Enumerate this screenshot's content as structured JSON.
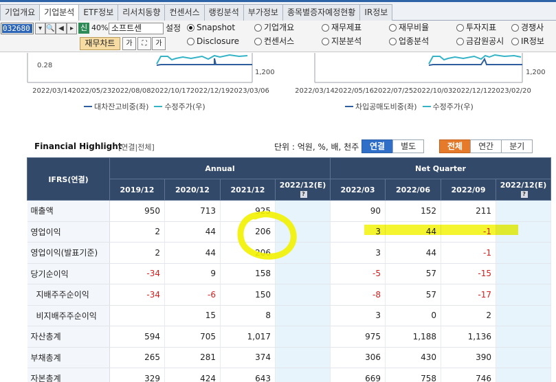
{
  "tabs": [
    {
      "label": "기업개요",
      "active": false
    },
    {
      "label": "기업분석",
      "active": true
    },
    {
      "label": "ETF정보",
      "active": false
    },
    {
      "label": "리서치동향",
      "active": false
    },
    {
      "label": "컨센서스",
      "active": false
    },
    {
      "label": "랭킹분석",
      "active": false
    },
    {
      "label": "부가정보",
      "active": false
    },
    {
      "label": "종목별증자예정현황",
      "active": false
    },
    {
      "label": "IR정보",
      "active": false
    }
  ],
  "toolbar": {
    "code": "032680",
    "shin": "신",
    "pct": "40%",
    "company": "소프트센",
    "setting": "설정",
    "fin_chart": "재무차트",
    "btn_ga": "가",
    "btn_ga2": "가"
  },
  "radios": [
    {
      "label": "Snapshot",
      "checked": true
    },
    {
      "label": "기업개요",
      "checked": false
    },
    {
      "label": "재무제표",
      "checked": false
    },
    {
      "label": "재무비율",
      "checked": false
    },
    {
      "label": "투자지표",
      "checked": false
    },
    {
      "label": "경쟁사",
      "checked": false
    },
    {
      "label": "Disclosure",
      "checked": false
    },
    {
      "label": "컨센서스",
      "checked": false
    },
    {
      "label": "지분분석",
      "checked": false
    },
    {
      "label": "업종분석",
      "checked": false
    },
    {
      "label": "금감원공시",
      "checked": false
    },
    {
      "label": "IR정보",
      "checked": false
    }
  ],
  "charts": {
    "left": {
      "ytick_left": "0.28",
      "ytick_right": "1,200",
      "xticks": [
        "2022/03/14",
        "2022/05/23",
        "2022/08/08",
        "2022/10/17",
        "2022/12/19",
        "2023/03/06"
      ],
      "legend": [
        "대차잔고비중(좌)",
        "수정주가(우)"
      ]
    },
    "right": {
      "ytick_right": "1,200",
      "xticks": [
        "2022/03/14",
        "2022/05/16",
        "2022/07/25",
        "2022/10/03",
        "2022/12/12",
        "2023/02/20"
      ],
      "legend": [
        "차입공매도비중(좌)",
        "수정주가(우)"
      ]
    },
    "colors": {
      "ratio": "#2f5e9e",
      "price": "#34b3c7"
    }
  },
  "financial": {
    "title": "Financial Highlight",
    "subtitle": "[연결|전체]",
    "unit": "단위 : 억원, %, 배, 천주",
    "toggle1": [
      {
        "label": "연결",
        "selected": true
      },
      {
        "label": "별도",
        "selected": false
      }
    ],
    "toggle2": [
      {
        "label": "전체",
        "selected": true
      },
      {
        "label": "연간",
        "selected": false
      },
      {
        "label": "분기",
        "selected": false
      }
    ],
    "header": {
      "ifrs": "IFRS(연결)",
      "annual": "Annual",
      "quarter": "Net Quarter",
      "cols": [
        "2019/12",
        "2020/12",
        "2021/12",
        "2022/12(E)",
        "2022/03",
        "2022/06",
        "2022/09",
        "2022/12(E)"
      ]
    },
    "rows": [
      {
        "label": "매출액",
        "indent": false,
        "values": [
          "950",
          "713",
          "925",
          "",
          "90",
          "152",
          "211",
          ""
        ]
      },
      {
        "label": "영업이익",
        "indent": false,
        "values": [
          "2",
          "44",
          "206",
          "",
          "3",
          "44",
          "-1",
          ""
        ]
      },
      {
        "label": "영업이익(발표기준)",
        "indent": false,
        "values": [
          "2",
          "44",
          "206",
          "",
          "3",
          "44",
          "-1",
          ""
        ]
      },
      {
        "label": "당기순이익",
        "indent": false,
        "values": [
          "-34",
          "9",
          "158",
          "",
          "-5",
          "57",
          "-15",
          ""
        ]
      },
      {
        "label": "지배주주순이익",
        "indent": true,
        "values": [
          "-34",
          "-6",
          "150",
          "",
          "-8",
          "57",
          "-17",
          ""
        ]
      },
      {
        "label": "비지배주주순이익",
        "indent": true,
        "values": [
          "",
          "15",
          "8",
          "",
          "3",
          "0",
          "2",
          ""
        ]
      },
      {
        "label": "자산총계",
        "indent": false,
        "values": [
          "594",
          "705",
          "1,017",
          "",
          "975",
          "1,188",
          "1,136",
          ""
        ]
      },
      {
        "label": "부채총계",
        "indent": false,
        "values": [
          "265",
          "281",
          "374",
          "",
          "306",
          "430",
          "390",
          ""
        ]
      },
      {
        "label": "자본총계",
        "indent": false,
        "values": [
          "329",
          "424",
          "643",
          "",
          "669",
          "758",
          "746",
          ""
        ]
      }
    ]
  }
}
